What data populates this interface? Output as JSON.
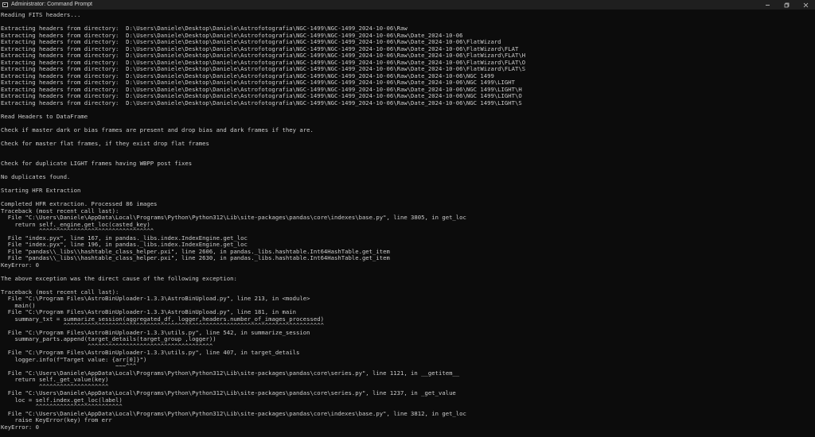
{
  "window": {
    "title": "Administrator: Command Prompt",
    "controls": {
      "minimize_icon": "minimize-icon",
      "maximize_icon": "restore-icon",
      "close_icon": "close-icon"
    },
    "colors": {
      "background": "#0c0c0c",
      "titlebar": "#1f1f1f",
      "text": "#cccccc"
    }
  },
  "console": {
    "lines": [
      "Reading FITS headers...",
      "",
      "Extracting headers from directory:  D:\\Users\\Daniele\\Desktop\\Daniele\\Astrofotografia\\NGC-1499\\NGC-1499_2024-10-06\\Raw",
      "Extracting headers from directory:  D:\\Users\\Daniele\\Desktop\\Daniele\\Astrofotografia\\NGC-1499\\NGC-1499_2024-10-06\\Raw\\Date_2024-10-06",
      "Extracting headers from directory:  D:\\Users\\Daniele\\Desktop\\Daniele\\Astrofotografia\\NGC-1499\\NGC-1499_2024-10-06\\Raw\\Date_2024-10-06\\FlatWizard",
      "Extracting headers from directory:  D:\\Users\\Daniele\\Desktop\\Daniele\\Astrofotografia\\NGC-1499\\NGC-1499_2024-10-06\\Raw\\Date_2024-10-06\\FlatWizard\\FLAT",
      "Extracting headers from directory:  D:\\Users\\Daniele\\Desktop\\Daniele\\Astrofotografia\\NGC-1499\\NGC-1499_2024-10-06\\Raw\\Date_2024-10-06\\FlatWizard\\FLAT\\H",
      "Extracting headers from directory:  D:\\Users\\Daniele\\Desktop\\Daniele\\Astrofotografia\\NGC-1499\\NGC-1499_2024-10-06\\Raw\\Date_2024-10-06\\FlatWizard\\FLAT\\O",
      "Extracting headers from directory:  D:\\Users\\Daniele\\Desktop\\Daniele\\Astrofotografia\\NGC-1499\\NGC-1499_2024-10-06\\Raw\\Date_2024-10-06\\FlatWizard\\FLAT\\S",
      "Extracting headers from directory:  D:\\Users\\Daniele\\Desktop\\Daniele\\Astrofotografia\\NGC-1499\\NGC-1499_2024-10-06\\Raw\\Date_2024-10-06\\NGC 1499",
      "Extracting headers from directory:  D:\\Users\\Daniele\\Desktop\\Daniele\\Astrofotografia\\NGC-1499\\NGC-1499_2024-10-06\\Raw\\Date_2024-10-06\\NGC 1499\\LIGHT",
      "Extracting headers from directory:  D:\\Users\\Daniele\\Desktop\\Daniele\\Astrofotografia\\NGC-1499\\NGC-1499_2024-10-06\\Raw\\Date_2024-10-06\\NGC 1499\\LIGHT\\H",
      "Extracting headers from directory:  D:\\Users\\Daniele\\Desktop\\Daniele\\Astrofotografia\\NGC-1499\\NGC-1499_2024-10-06\\Raw\\Date_2024-10-06\\NGC 1499\\LIGHT\\O",
      "Extracting headers from directory:  D:\\Users\\Daniele\\Desktop\\Daniele\\Astrofotografia\\NGC-1499\\NGC-1499_2024-10-06\\Raw\\Date_2024-10-06\\NGC 1499\\LIGHT\\S",
      "",
      "Read Headers to DataFrame",
      "",
      "Check if master dark or bias frames are present and drop bias and dark frames if they are.",
      "",
      "Check for master flat frames, if they exist drop flat frames",
      "",
      "",
      "Check for duplicate LIGHT frames having WBPP post fixes",
      "",
      "No duplicates found.",
      "",
      "Starting HFR Extraction",
      "",
      "Completed HFR extraction. Processed 86 images",
      "Traceback (most recent call last):",
      "  File \"C:\\Users\\Daniele\\AppData\\Local\\Programs\\Python\\Python312\\Lib\\site-packages\\pandas\\core\\indexes\\base.py\", line 3805, in get_loc",
      "    return self._engine.get_loc(casted_key)",
      "           ^^^^^^^^^^^^^^^^^^^^^^^^^^^^^^^^^",
      "  File \"index.pyx\", line 167, in pandas._libs.index.IndexEngine.get_loc",
      "  File \"index.pyx\", line 196, in pandas._libs.index.IndexEngine.get_loc",
      "  File \"pandas\\\\_libs\\\\hashtable_class_helper.pxi\", line 2606, in pandas._libs.hashtable.Int64HashTable.get_item",
      "  File \"pandas\\\\_libs\\\\hashtable_class_helper.pxi\", line 2630, in pandas._libs.hashtable.Int64HashTable.get_item",
      "KeyError: 0",
      "",
      "The above exception was the direct cause of the following exception:",
      "",
      "Traceback (most recent call last):",
      "  File \"C:\\Program Files\\AstroBinUploader-1.3.3\\AstroBinUpload.py\", line 213, in <module>",
      "    main()",
      "  File \"C:\\Program Files\\AstroBinUploader-1.3.3\\AstroBinUpload.py\", line 181, in main",
      "    summary_txt = summarize_session(aggregated_df, logger,headers.number_of_images_processed)",
      "                  ^^^^^^^^^^^^^^^^^^^^^^^^^^^^^^^^^^^^^^^^^^^^^^^^^^^^^^^^^^^^^^^^^^^^^^^^^^^",
      "  File \"C:\\Program Files\\AstroBinUploader-1.3.3\\utils.py\", line 542, in summarize_session",
      "    summary_parts.append(target_details(target_group ,logger))",
      "                         ^^^^^^^^^^^^^^^^^^^^^^^^^^^^^^^^^^^^",
      "  File \"C:\\Program Files\\AstroBinUploader-1.3.3\\utils.py\", line 407, in target_details",
      "    logger.info(f\"Target value: {arr[0]}\")",
      "                                 ~~~^^^",
      "  File \"C:\\Users\\Daniele\\AppData\\Local\\Programs\\Python\\Python312\\Lib\\site-packages\\pandas\\core\\series.py\", line 1121, in __getitem__",
      "    return self._get_value(key)",
      "           ^^^^^^^^^^^^^^^^^^^^",
      "  File \"C:\\Users\\Daniele\\AppData\\Local\\Programs\\Python\\Python312\\Lib\\site-packages\\pandas\\core\\series.py\", line 1237, in _get_value",
      "    loc = self.index.get_loc(label)",
      "          ^^^^^^^^^^^^^^^^^^^^^^^^^",
      "  File \"C:\\Users\\Daniele\\AppData\\Local\\Programs\\Python\\Python312\\Lib\\site-packages\\pandas\\core\\indexes\\base.py\", line 3812, in get_loc",
      "    raise KeyError(key) from err",
      "KeyError: 0"
    ]
  }
}
